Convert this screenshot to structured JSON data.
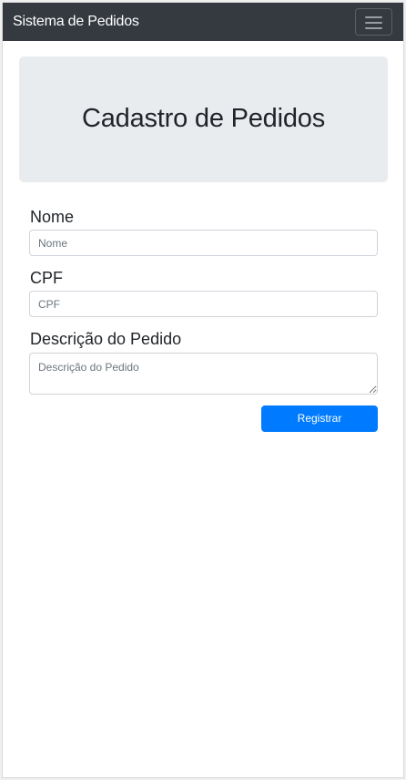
{
  "navbar": {
    "brand": "Sistema de Pedidos",
    "toggler_icon": "hamburger-menu-icon"
  },
  "jumbotron": {
    "title": "Cadastro de Pedidos"
  },
  "form": {
    "nome": {
      "label": "Nome",
      "placeholder": "Nome",
      "value": ""
    },
    "cpf": {
      "label": "CPF",
      "placeholder": "CPF",
      "value": ""
    },
    "descricao": {
      "label": "Descrição do Pedido",
      "placeholder": "Descrição do Pedido",
      "value": ""
    },
    "submit_label": "Registrar"
  },
  "colors": {
    "navbar_bg": "#343a40",
    "jumbotron_bg": "#e9ecef",
    "primary": "#007bff",
    "text": "#212529"
  }
}
